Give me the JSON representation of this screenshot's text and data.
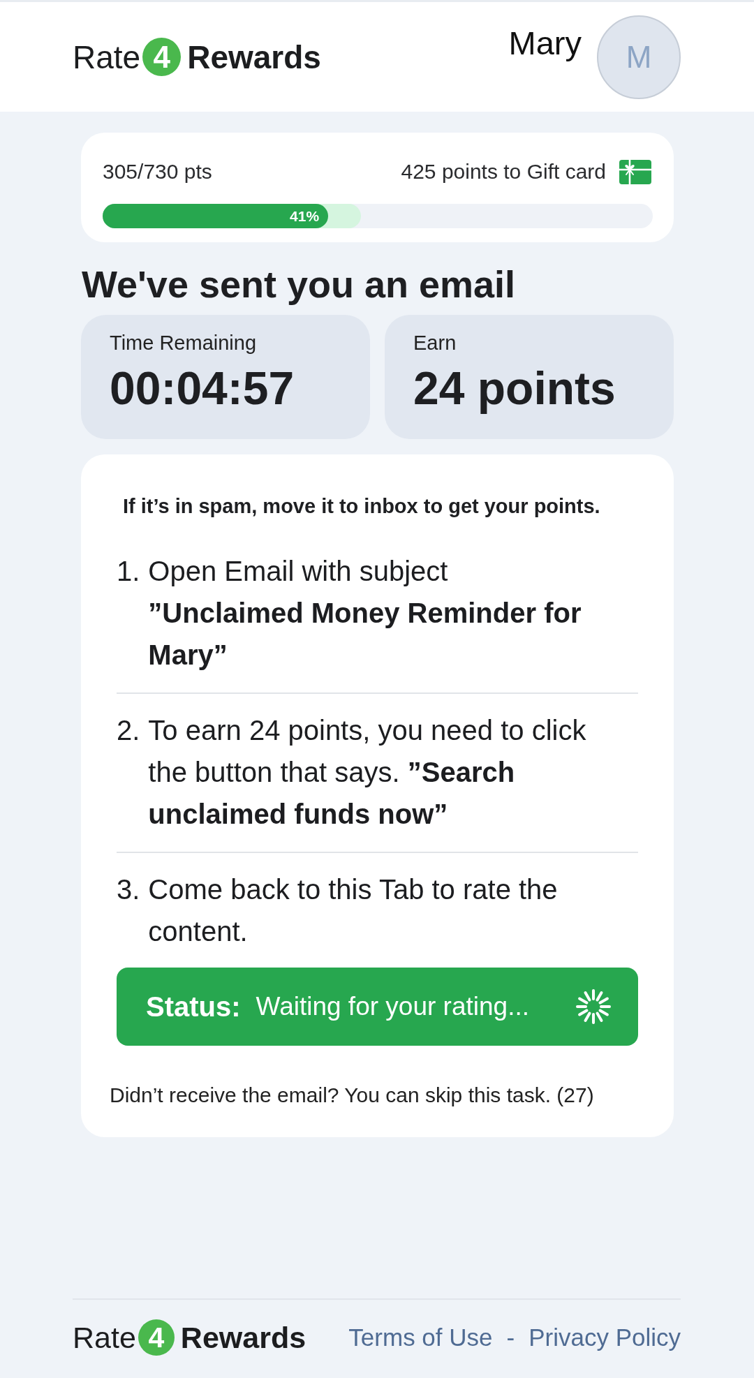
{
  "header": {
    "logo": {
      "left": "Rate",
      "digit": "4",
      "right": "Rewards"
    },
    "user_name": "Mary",
    "avatar_initial": "M"
  },
  "progress": {
    "points": "305/730 pts",
    "goal": "425 points to Gift card",
    "level": 0.41,
    "percent": "41%"
  },
  "title": "We've sent you an email",
  "stats": [
    {
      "label": "Time Remaining",
      "value": "00:04:57"
    },
    {
      "label": "Earn",
      "value": "24 points"
    }
  ],
  "instructions": {
    "note": "If it’s in spam, move it to inbox to get your points.",
    "steps": [
      {
        "number": "1.",
        "text": "Open Email with subject",
        "subject": "”Unclaimed Money Reminder for Mary”"
      },
      {
        "number": "2.",
        "text": "To earn 24 points, you need to click the button that says. **”Search unclaimed funds now”**"
      },
      {
        "number": "3.",
        "text": "Come back to this Tab to rate the content."
      }
    ],
    "status": {
      "kind": "waiting",
      "label": "Status:",
      "message": "Waiting for your rating..."
    },
    "skip_note": "Didn’t receive the email? You can skip this task. (27)"
  },
  "footer": {
    "logo": {
      "left": "Rate",
      "digit": "4",
      "right": "Rewards"
    },
    "links": [
      {
        "label": "Terms of Use"
      },
      {
        "label": "Privacy Policy"
      }
    ],
    "separator": "-"
  }
}
